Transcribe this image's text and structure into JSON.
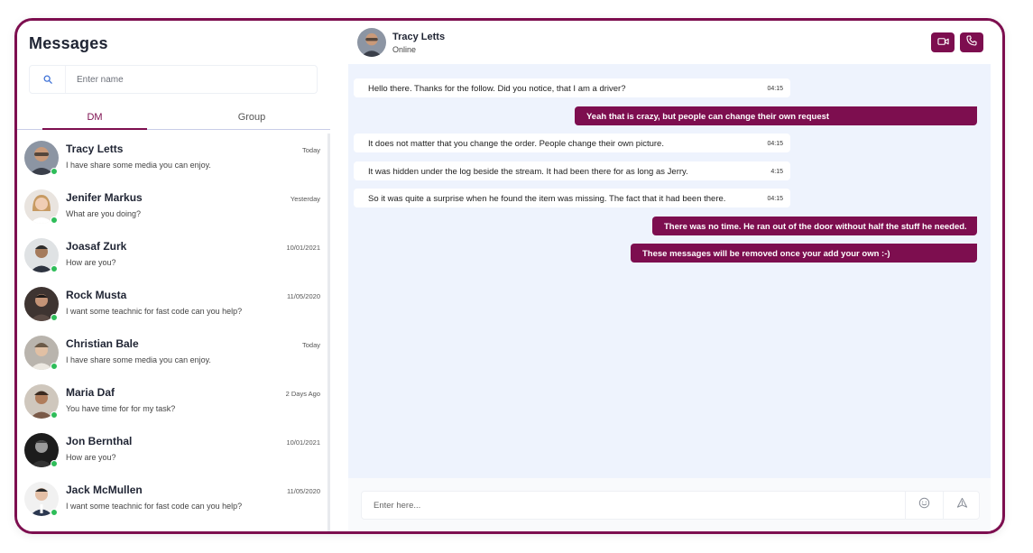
{
  "sidebar": {
    "title": "Messages",
    "search_placeholder": "Enter name",
    "tabs": [
      {
        "label": "DM"
      },
      {
        "label": "Group"
      }
    ],
    "contacts": [
      {
        "name": "Tracy Letts",
        "message": "I have share some media you can enjoy.",
        "time": "Today"
      },
      {
        "name": "Jenifer Markus",
        "message": "What are you doing?",
        "time": "Yesterday"
      },
      {
        "name": "Joasaf Zurk",
        "message": "How are you?",
        "time": "10/01/2021"
      },
      {
        "name": "Rock Musta",
        "message": "I want some teachnic for fast code can you help?",
        "time": "11/05/2020"
      },
      {
        "name": "Christian Bale",
        "message": "I have share some media you can enjoy.",
        "time": "Today"
      },
      {
        "name": "Maria Daf",
        "message": "You have time for for my task?",
        "time": "2 Days Ago"
      },
      {
        "name": "Jon Bernthal",
        "message": "How are you?",
        "time": "10/01/2021"
      },
      {
        "name": "Jack McMullen",
        "message": "I want some teachnic for fast code can you help?",
        "time": "11/05/2020"
      }
    ]
  },
  "header": {
    "name": "Tracy Letts",
    "status": "Online"
  },
  "messages": [
    {
      "dir": "in",
      "text": "Hello there. Thanks for the follow. Did you notice, that I am a driver?",
      "time": "04:15"
    },
    {
      "dir": "out",
      "text": "Yeah that is crazy, but people can change their own request"
    },
    {
      "dir": "in",
      "text": "It does not matter that you change the order. People change their own picture.",
      "time": "04:15"
    },
    {
      "dir": "in",
      "text": "It was hidden under the log beside the stream. It had been there for as long as Jerry.",
      "time": "4:15"
    },
    {
      "dir": "in",
      "text": "So it was quite a surprise when he found the item was missing. The fact that it had been there.",
      "time": "04:15"
    },
    {
      "dir": "out",
      "text": "There was no time. He ran out of the door without half the stuff he needed."
    },
    {
      "dir": "out",
      "text": "These messages will be removed once your add your own    :-)"
    }
  ],
  "composer": {
    "placeholder": "Enter here..."
  },
  "colors": {
    "accent": "#7d0e4f",
    "online": "#2ebd59",
    "chat_bg": "#eef3fd"
  }
}
